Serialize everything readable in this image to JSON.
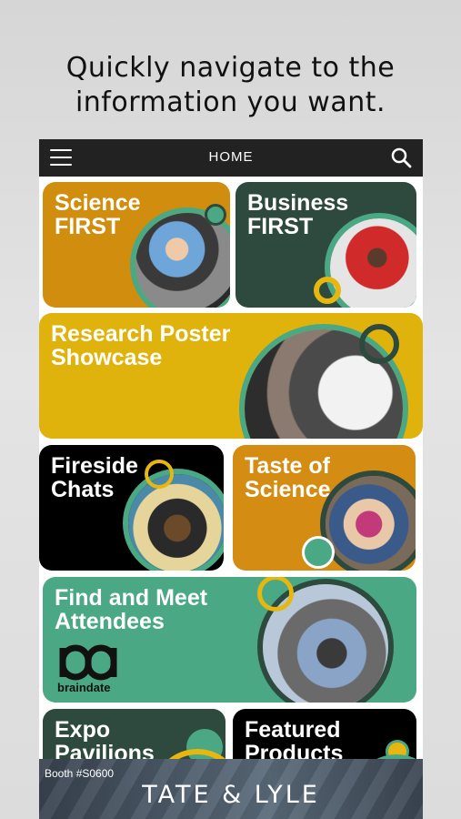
{
  "headline": {
    "line1": "Quickly navigate to the",
    "line2": "information you want."
  },
  "topbar": {
    "title": "HOME",
    "menu_icon": "hamburger-menu-icon",
    "search_icon": "search-icon"
  },
  "tiles": [
    {
      "line1": "Science",
      "line2": "FIRST",
      "color": "#d18d0e"
    },
    {
      "line1": "Business",
      "line2": "FIRST",
      "color": "#2e4a3e"
    },
    {
      "line1": "Research Poster",
      "line2": "Showcase",
      "color": "#e0b20c"
    },
    {
      "line1": "Fireside",
      "line2": "Chats",
      "color": "#000000"
    },
    {
      "line1": "Taste of",
      "line2": "Science",
      "color": "#d48c12"
    },
    {
      "line1": "Find and Meet",
      "line2": "Attendees",
      "color": "#4aa884",
      "logo_text": "braindate"
    },
    {
      "line1": "Expo",
      "line2": "Pavilions",
      "color": "#2e4a3e"
    },
    {
      "line1": "Featured",
      "line2": "Products",
      "color": "#000000"
    }
  ],
  "banner": {
    "booth": "Booth #S0600",
    "logo": "TATE & LYLE"
  },
  "colors": {
    "accent_teal": "#4aa884",
    "accent_yellow": "#e8b70f",
    "dark_green": "#2e4a3e"
  }
}
